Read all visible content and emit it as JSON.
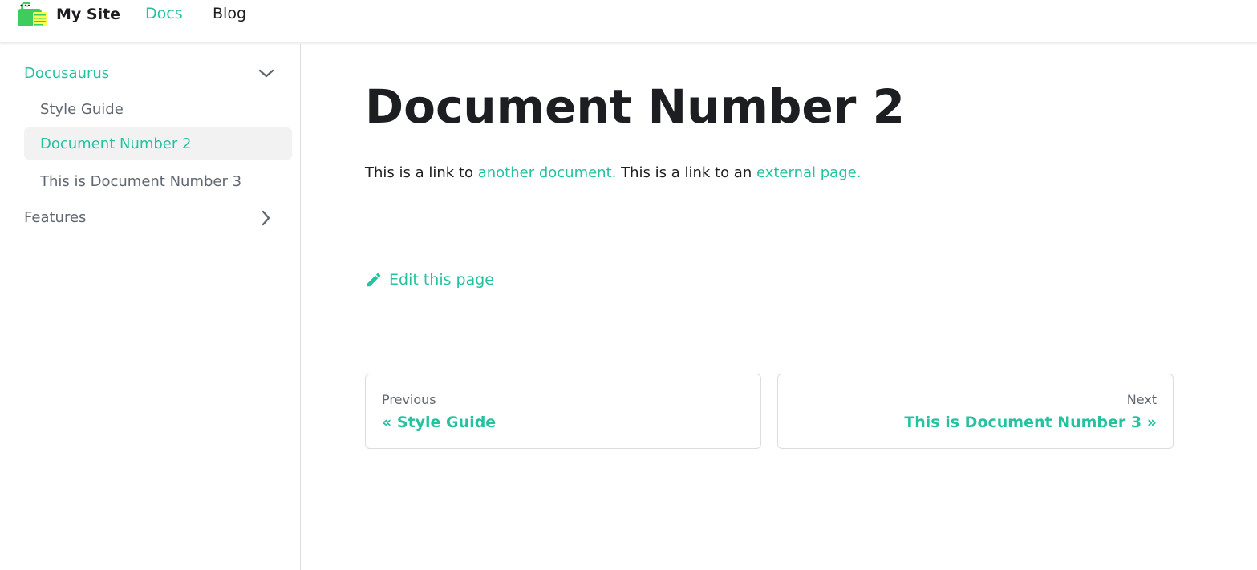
{
  "navbar": {
    "brand_title": "My Site",
    "links": [
      {
        "label": "Docs",
        "active": true
      },
      {
        "label": "Blog",
        "active": false
      }
    ]
  },
  "sidebar": {
    "categories": [
      {
        "label": "Docusaurus",
        "expanded": true,
        "items": [
          {
            "label": "Style Guide",
            "active": false
          },
          {
            "label": "Document Number 2",
            "active": true
          },
          {
            "label": "This is Document Number 3",
            "active": false
          }
        ]
      },
      {
        "label": "Features",
        "expanded": false
      }
    ]
  },
  "doc": {
    "title": "Document Number 2",
    "para_text_1": "This is a link to ",
    "para_link_1": "another document.",
    "para_text_2": " This is a link to an ",
    "para_link_2": "external page.",
    "edit_label": "Edit this page"
  },
  "pagination": {
    "prev_sub": "Previous",
    "prev_label": "« Style Guide",
    "next_sub": "Next",
    "next_label": "This is Document Number 3 »"
  },
  "colors": {
    "accent": "#25c2a0",
    "text": "#1c1e21",
    "muted": "#606770",
    "active_bg": "#f2f2f2"
  },
  "icons": {
    "brand": "docusaurus-logo",
    "expanded": "chevron-down-icon",
    "collapsed": "chevron-right-icon",
    "edit": "pencil-icon"
  }
}
